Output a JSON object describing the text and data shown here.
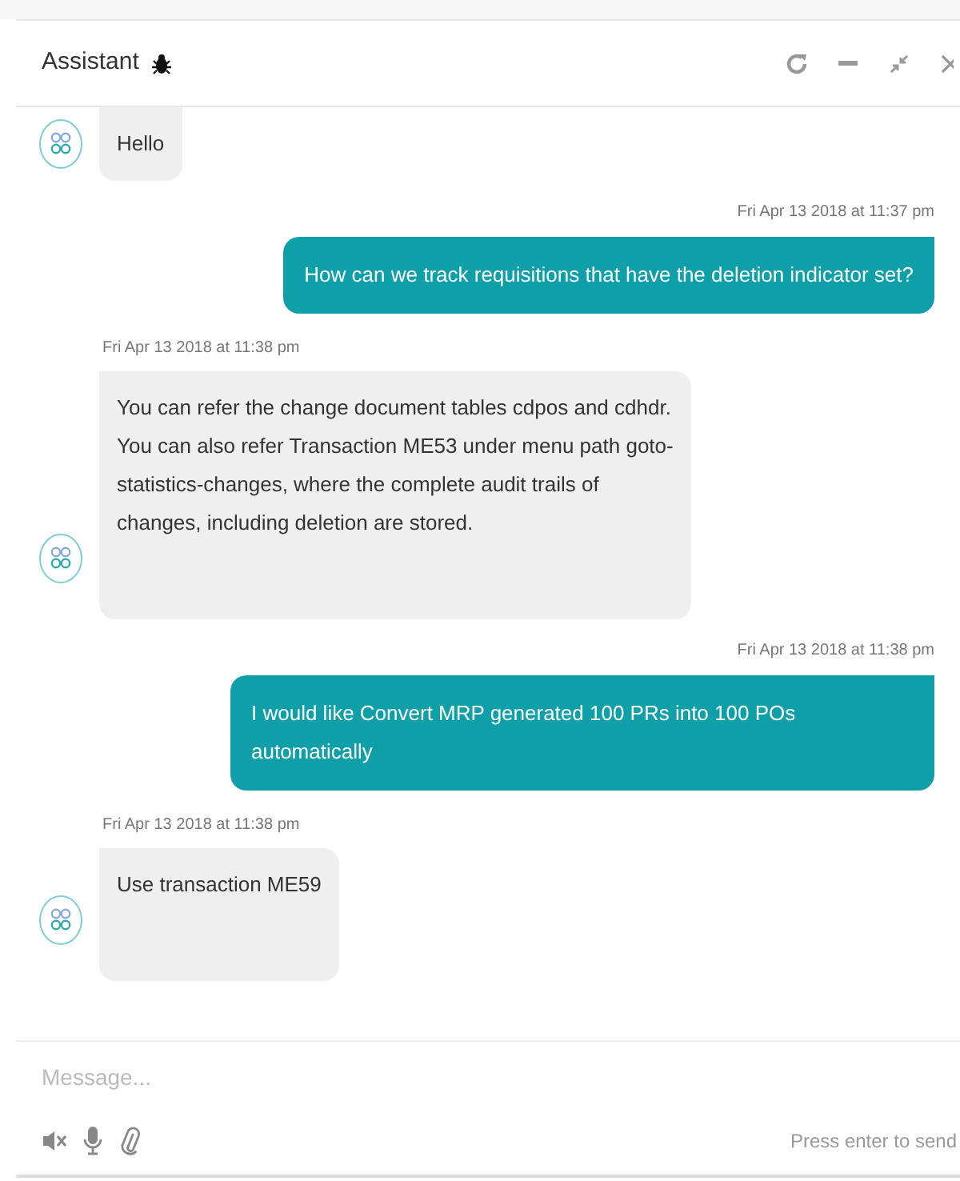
{
  "header": {
    "title": "Assistant"
  },
  "messages": [
    {
      "kind": "bot",
      "text": "Hello"
    },
    {
      "kind": "user",
      "time": "Fri Apr 13 2018 at 11:37 pm",
      "text": "How can we track requisitions that have the deletion indicator set?"
    },
    {
      "kind": "bot",
      "time": "Fri Apr 13 2018 at 11:38 pm",
      "text": "You can refer the change document tables cdpos and cdhdr. You can also refer Transaction ME53 under menu path goto-statistics-changes, where the complete audit trails of changes, including deletion are stored."
    },
    {
      "kind": "user",
      "time": "Fri Apr 13 2018 at 11:38 pm",
      "text": "I would like Convert MRP generated 100 PRs into 100 POs automatically"
    },
    {
      "kind": "bot",
      "time": "Fri Apr 13 2018 at 11:38 pm",
      "text": "Use transaction ME59"
    }
  ],
  "composer": {
    "placeholder": "Message...",
    "hint": "Press enter to send"
  }
}
